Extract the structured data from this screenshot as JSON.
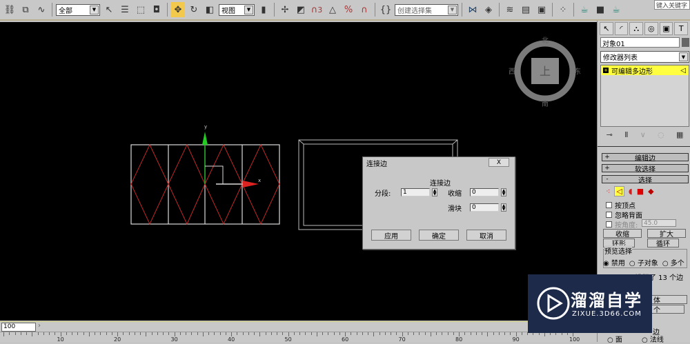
{
  "toolbar": {
    "selection_filter": "全部",
    "ref_coord": "视图",
    "named_selection": "创建选择集",
    "snap_label": "3",
    "search_placeholder": "键入关键字"
  },
  "viewport": {
    "viewcube_face": "上",
    "compass": {
      "north": "北",
      "south": "南",
      "east": "东",
      "west": "西"
    },
    "gizmo_x": "x",
    "gizmo_y": "y"
  },
  "panel": {
    "object_name": "对象01",
    "modifier_list": "修改器列表",
    "stack_item": "可编辑多边形",
    "rollouts": {
      "edit_edges": "编辑边",
      "soft_selection": "软选择",
      "selection": "选择"
    },
    "by_vertex": "按顶点",
    "ignore_backfacing": "忽略背面",
    "by_angle": "按角度:",
    "angle_value": "45.0",
    "shrink": "收缩",
    "grow": "扩大",
    "ring": "环形",
    "loop": "循环",
    "preview_group": "预览选择",
    "preview_options": [
      "禁用",
      "子对象",
      "多个"
    ],
    "selected_status": "选择了 13 个边",
    "partial_1": "体",
    "partial_2": "个",
    "partial_3": "边",
    "face": "面",
    "normal": "法线"
  },
  "dialog": {
    "title": "连接边",
    "close": "X",
    "group_title": "连接边",
    "segments_label": "分段:",
    "segments_value": "1",
    "pinch_label": "收缩",
    "pinch_value": "0",
    "slide_label": "滑块",
    "slide_value": "0",
    "apply": "应用",
    "ok": "确定",
    "cancel": "取消"
  },
  "timeline": {
    "frame": "100",
    "ticks": [
      "10",
      "20",
      "30",
      "40",
      "50",
      "60",
      "70",
      "80",
      "90",
      "100"
    ]
  },
  "watermark": {
    "brand": "溜溜自学",
    "url": "ZIXUE.3D66.COM"
  },
  "colors": {
    "active": "#f2c94c",
    "stack_highlight": "#ffff40",
    "edge_selected": "#d02020"
  }
}
